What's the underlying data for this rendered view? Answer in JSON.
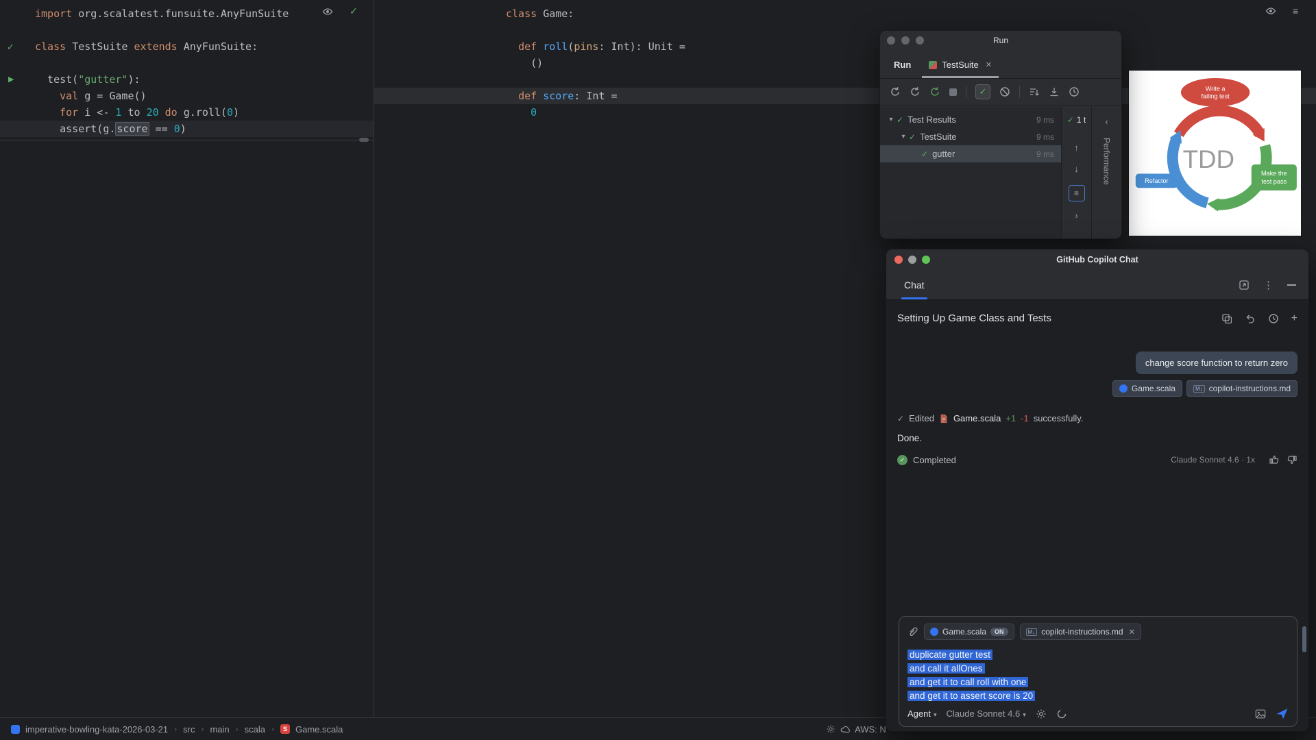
{
  "editor_left": {
    "lines": [
      {
        "tokens": [
          {
            "t": "import ",
            "c": "kw"
          },
          {
            "t": "org.scalatest.funsuite.AnyFunSuite",
            "c": "pl"
          }
        ]
      },
      {
        "tokens": []
      },
      {
        "tokens": [
          {
            "t": "class ",
            "c": "kw"
          },
          {
            "t": "TestSuite ",
            "c": "pl"
          },
          {
            "t": "extends ",
            "c": "kw"
          },
          {
            "t": "AnyFunSuite:",
            "c": "pl"
          }
        ]
      },
      {
        "tokens": []
      },
      {
        "tokens": [
          {
            "t": "  test(",
            "c": "pl"
          },
          {
            "t": "\"gutter\"",
            "c": "str"
          },
          {
            "t": "):",
            "c": "pl"
          }
        ]
      },
      {
        "tokens": [
          {
            "t": "    ",
            "c": "pl"
          },
          {
            "t": "val ",
            "c": "kw"
          },
          {
            "t": "g = Game()",
            "c": "pl"
          }
        ]
      },
      {
        "tokens": [
          {
            "t": "    ",
            "c": "pl"
          },
          {
            "t": "for ",
            "c": "kw"
          },
          {
            "t": "i <- ",
            "c": "pl"
          },
          {
            "t": "1",
            "c": "num"
          },
          {
            "t": " to ",
            "c": "pl"
          },
          {
            "t": "20",
            "c": "num"
          },
          {
            "t": " ",
            "c": "pl"
          },
          {
            "t": "do ",
            "c": "kw"
          },
          {
            "t": "g.roll(",
            "c": "pl"
          },
          {
            "t": "0",
            "c": "num"
          },
          {
            "t": ")",
            "c": "pl"
          }
        ]
      },
      {
        "hl": true,
        "tokens": [
          {
            "t": "    assert(g.",
            "c": "pl"
          },
          {
            "t": "score",
            "c": "pl",
            "box": true
          },
          {
            "t": " == ",
            "c": "pl"
          },
          {
            "t": "0",
            "c": "num"
          },
          {
            "t": ")",
            "c": "pl"
          }
        ]
      }
    ]
  },
  "editor_right": {
    "lines": [
      {
        "tokens": [
          {
            "t": "class ",
            "c": "kw"
          },
          {
            "t": "Game:",
            "c": "pl"
          }
        ]
      },
      {
        "tokens": []
      },
      {
        "tokens": [
          {
            "t": "  ",
            "c": "pl"
          },
          {
            "t": "def ",
            "c": "kw"
          },
          {
            "t": "roll",
            "c": "fn"
          },
          {
            "t": "(",
            "c": "pl"
          },
          {
            "t": "pins",
            "c": "par"
          },
          {
            "t": ": Int): Unit =",
            "c": "pl"
          }
        ]
      },
      {
        "tokens": [
          {
            "t": "    ()",
            "c": "pl"
          }
        ]
      },
      {
        "tokens": []
      },
      {
        "hl": true,
        "tokens": [
          {
            "t": "  ",
            "c": "pl"
          },
          {
            "t": "def ",
            "c": "kw"
          },
          {
            "t": "score",
            "c": "fn"
          },
          {
            "t": ": Int =",
            "c": "pl"
          }
        ]
      },
      {
        "tokens": [
          {
            "t": "    ",
            "c": "pl"
          },
          {
            "t": "0",
            "c": "num"
          }
        ]
      }
    ]
  },
  "run_window": {
    "title": "Run",
    "pane_label": "Run",
    "tab_label": "TestSuite",
    "tree": [
      {
        "label": "Test Results",
        "time": "9 ms"
      },
      {
        "label": "TestSuite",
        "time": "9 ms"
      },
      {
        "label": "gutter",
        "time": "9 ms"
      }
    ],
    "passed_summary": "1 t",
    "side_tab": "Performance"
  },
  "tdd_diagram": {
    "center": "TDD",
    "red_line1": "Write a",
    "red_line2": "failing test",
    "green_line1": "Make the",
    "green_line2": "test pass",
    "blue_label": "Refactor",
    "colors": {
      "red": "#cf4a3f",
      "green": "#5aa95a",
      "blue": "#4a8fd3"
    }
  },
  "copilot": {
    "window_title": "GitHub Copilot Chat",
    "tab_label": "Chat",
    "session_title": "Setting Up Game Class and Tests",
    "user_message": "change score function to return zero",
    "ref_chip_1": "Game.scala",
    "ref_chip_2": "copilot-instructions.md",
    "edited": {
      "check_label": "Edited",
      "file": "Game.scala",
      "added": "+1",
      "removed": "-1",
      "suffix": "successfully."
    },
    "done_text": "Done.",
    "completed_label": "Completed",
    "model_usage": "Claude Sonnet 4.6 · 1x",
    "input": {
      "context_chip_1": "Game.scala",
      "context_chip_1_badge": "ON",
      "context_chip_2": "copilot-instructions.md",
      "lines": [
        "duplicate gutter test",
        "and call it allOnes",
        "and get it to call roll with one",
        "and get it to assert score is 20"
      ],
      "mode_label": "Agent",
      "model_label": "Claude Sonnet 4.6"
    }
  },
  "status_bar": {
    "project": "imperative-bowling-kata-2026-03-21",
    "sep": "›",
    "crumb_src": "src",
    "crumb_main": "main",
    "crumb_scala": "scala",
    "file": "Game.scala",
    "aws_label": "AWS: N"
  }
}
